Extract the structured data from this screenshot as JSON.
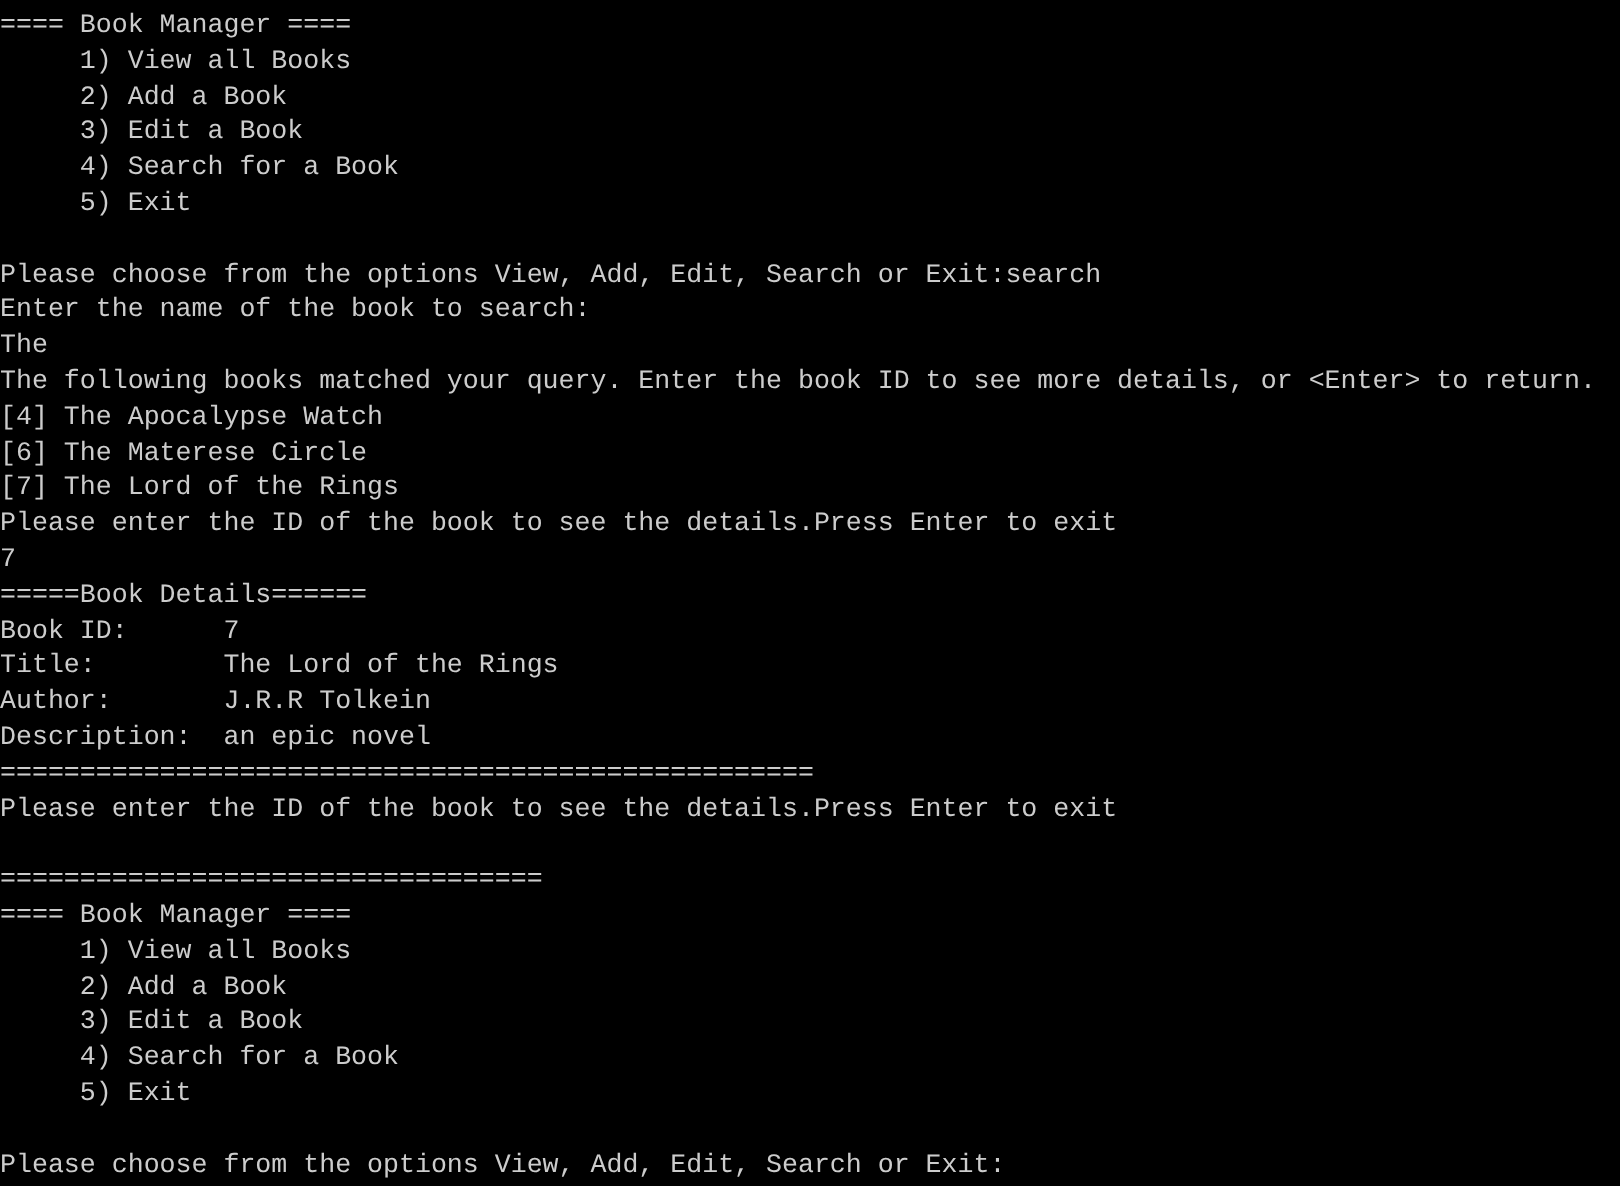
{
  "console": {
    "lines": [
      {
        "kind": "text",
        "text": "==== Book Manager ===="
      },
      {
        "kind": "text",
        "text": "     1) View all Books"
      },
      {
        "kind": "text",
        "text": "     2) Add a Book"
      },
      {
        "kind": "text",
        "text": "     3) Edit a Book"
      },
      {
        "kind": "text",
        "text": "     4) Search for a Book"
      },
      {
        "kind": "text",
        "text": "     5) Exit"
      },
      {
        "kind": "blank"
      },
      {
        "kind": "text",
        "text": "Please choose from the options View, Add, Edit, Search or Exit:search"
      },
      {
        "kind": "text",
        "text": "Enter the name of the book to search:"
      },
      {
        "kind": "text",
        "text": "The"
      },
      {
        "kind": "text",
        "text": "The following books matched your query. Enter the book ID to see more details, or <Enter> to return."
      },
      {
        "kind": "text",
        "text": "[4] The Apocalypse Watch"
      },
      {
        "kind": "text",
        "text": "[6] The Materese Circle"
      },
      {
        "kind": "text",
        "text": "[7] The Lord of the Rings"
      },
      {
        "kind": "text",
        "text": "Please enter the ID of the book to see the details.Press Enter to exit"
      },
      {
        "kind": "text",
        "text": "7"
      },
      {
        "kind": "text",
        "text": "=====Book Details======"
      },
      {
        "kind": "text",
        "text": "Book ID:      7"
      },
      {
        "kind": "text",
        "text": "Title:        The Lord of the Rings"
      },
      {
        "kind": "text",
        "text": "Author:       J.R.R Tolkein"
      },
      {
        "kind": "text",
        "text": "Description:  an epic novel"
      },
      {
        "kind": "text",
        "text": "==================================================="
      },
      {
        "kind": "text",
        "text": "Please enter the ID of the book to see the details.Press Enter to exit"
      },
      {
        "kind": "blank"
      },
      {
        "kind": "text",
        "text": "=================================="
      },
      {
        "kind": "text",
        "text": "==== Book Manager ===="
      },
      {
        "kind": "text",
        "text": "     1) View all Books"
      },
      {
        "kind": "text",
        "text": "     2) Add a Book"
      },
      {
        "kind": "text",
        "text": "     3) Edit a Book"
      },
      {
        "kind": "text",
        "text": "     4) Search for a Book"
      },
      {
        "kind": "text",
        "text": "     5) Exit"
      },
      {
        "kind": "blank"
      },
      {
        "kind": "text",
        "text": "Please choose from the options View, Add, Edit, Search or Exit:"
      }
    ]
  }
}
